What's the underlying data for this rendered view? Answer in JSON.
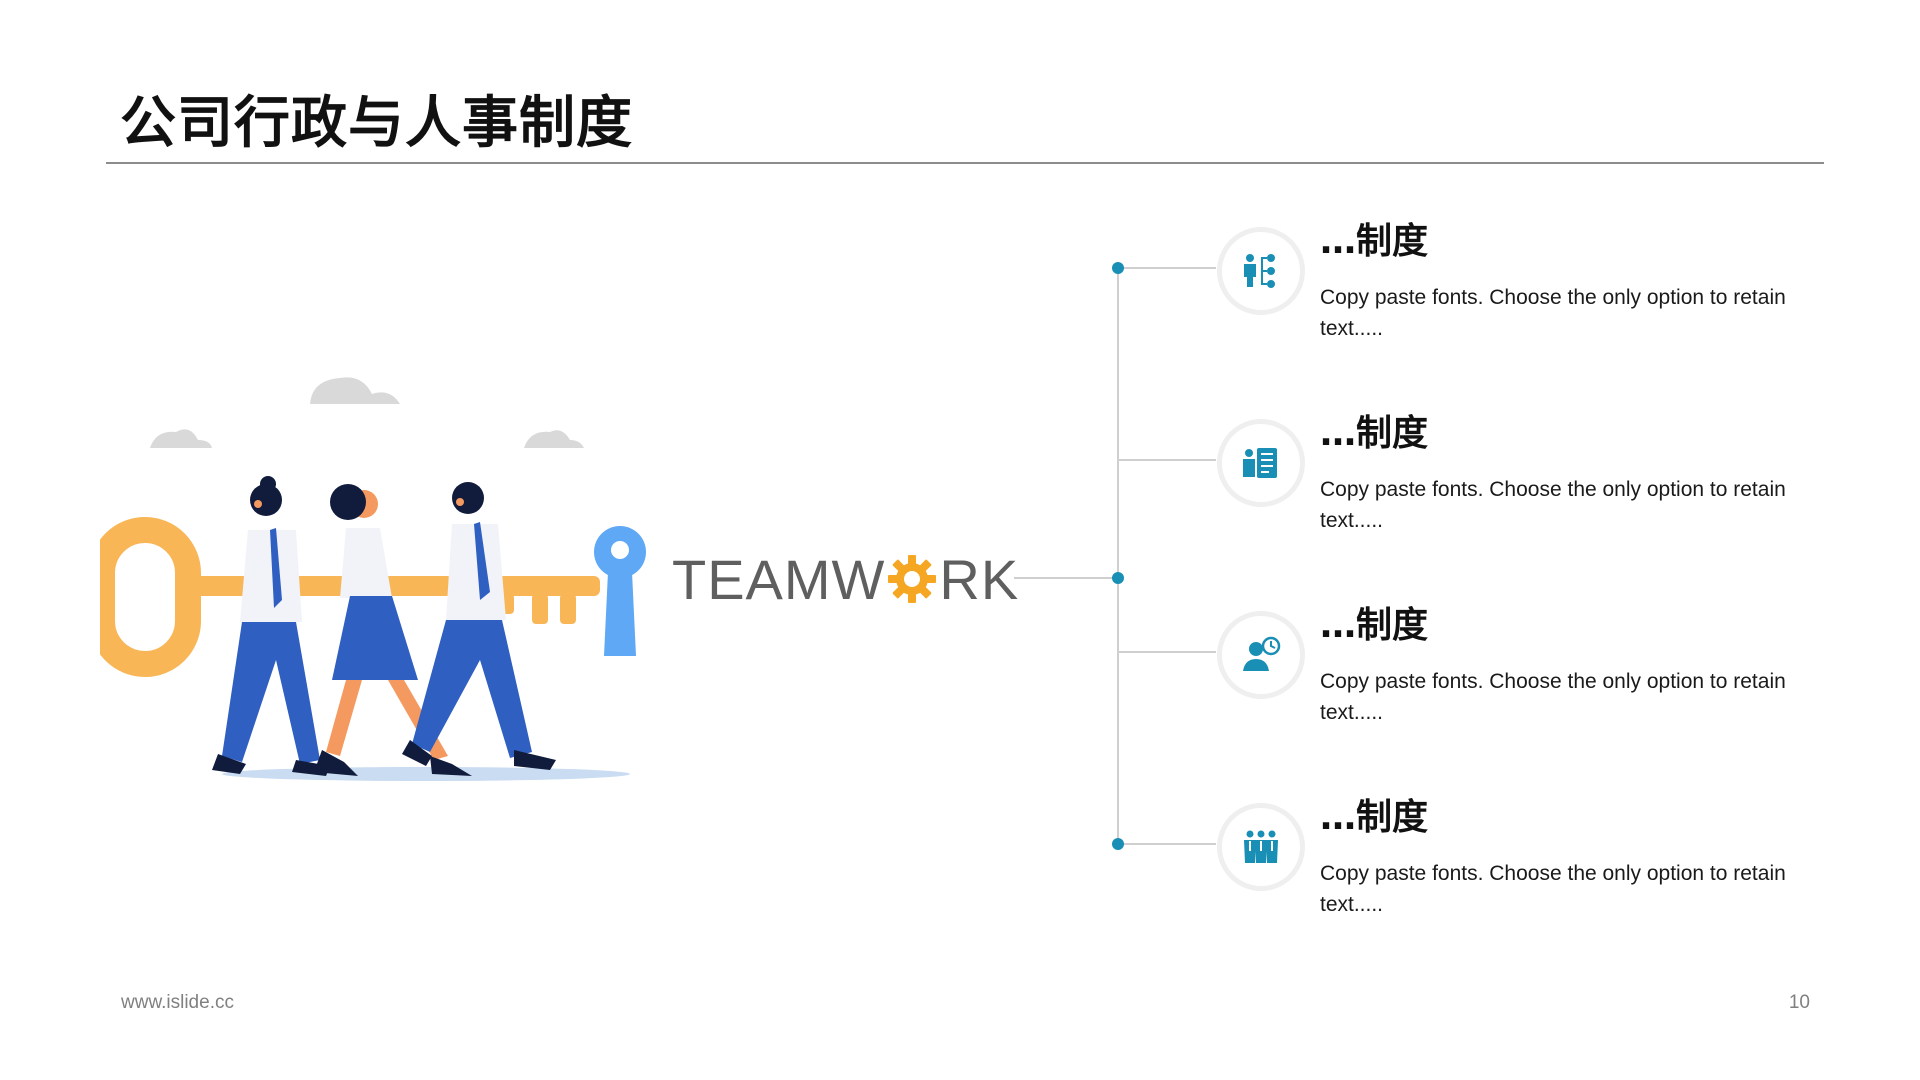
{
  "slide": {
    "title": "公司行政与人事制度",
    "footer_url": "www.islide.cc",
    "page_number": "10"
  },
  "teamwork": {
    "part1": "TEAMW",
    "part2": "RK"
  },
  "colors": {
    "accent": "#1a8fb5",
    "key": "#f8b657",
    "suit_blue": "#2f5fc0",
    "keyhole": "#5ea8f5",
    "text_gray": "#5f5f5f"
  },
  "items": [
    {
      "heading": "…制度",
      "text": "Copy paste fonts. Choose the only option to retain text.....",
      "icon": "org-chart-people-icon"
    },
    {
      "heading": "…制度",
      "text": "Copy paste fonts. Choose the only option to retain text.....",
      "icon": "person-document-icon"
    },
    {
      "heading": "…制度",
      "text": "Copy paste fonts. Choose the only option to retain text.....",
      "icon": "person-clock-icon"
    },
    {
      "heading": "…制度",
      "text": "Copy paste fonts. Choose the only option to retain text.....",
      "icon": "team-group-icon"
    }
  ]
}
